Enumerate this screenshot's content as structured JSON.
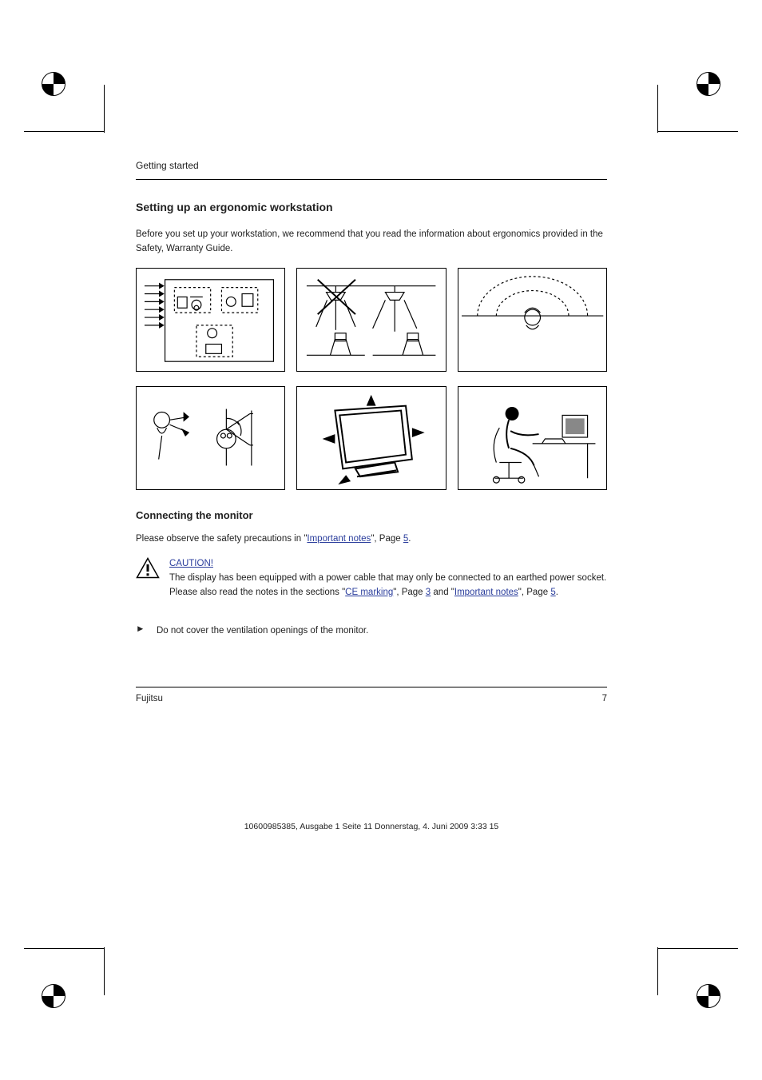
{
  "header": "Getting started",
  "section_title": "Setting up an ergonomic workstation",
  "intro_text": "Before you set up your workstation, we recommend that you read the information about ergonomics provided in the Safety, Warranty Guide.",
  "sub_title": "Connecting the monitor",
  "connect_intro_1": "Please observe the safety precautions in \"",
  "connect_link_1": "Important notes",
  "connect_intro_2": "\", Page",
  "connect_page_link_1": "5",
  "connect_intro_3": ".",
  "note_prefix": "CAUTION!",
  "note_body_1": "The display has been equipped with a power cable that may only be connected to an earthed power socket. Please also read the notes in the sections \"",
  "note_link_a": "CE marking",
  "note_body_2": "\", Page",
  "note_page_a": "3",
  "note_body_3": " and \"",
  "note_link_b": "Important notes",
  "note_body_4": "\", Page",
  "note_page_b": "5",
  "note_body_5": ".",
  "bullet": "►",
  "instr_text": "Do not cover the ventilation openings of the monitor.",
  "footer_left": "Fujitsu",
  "footer_right": "7",
  "print_footer": "10600985385, Ausgabe 1 Seite 11 Donnerstag, 4. Juni 2009 3:33 15"
}
